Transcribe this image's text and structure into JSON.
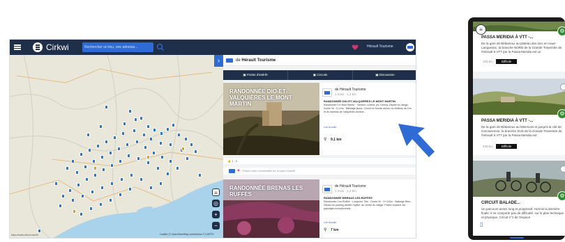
{
  "desktop": {
    "app_name": "Cirkwi",
    "search_placeholder": "Rechercher un lieu, une adresse...",
    "account_label": "Hérault Tourisme",
    "map": {
      "attribution": "Leaflet | © OpenStreetMap contributors © CARTO",
      "url": "https://www.cirkwi.com/fr/"
    },
    "panel": {
      "source_prefix": "de",
      "source_name": "Hérault Tourisme",
      "tabs": [
        {
          "label": "Points d'intérêt"
        },
        {
          "label": "Circuits"
        },
        {
          "label": "Discussion"
        }
      ],
      "cards": [
        {
          "title": "RANDONNÉE DIO-ET-VALQUIÈRES LE MONT MARTIN",
          "publisher": "de Hérault Tourisme",
          "meta": "1 mois · 1,2 km",
          "heading": "RANDONNÉE DIO-ET-VALQUIÈRES LE MONT MARTIN",
          "description": "Randonnée 'Le Mont Martin' · Secteur Lodève, pic Cerezy. Départ du village. Durée 3h · 9,1 km · Balisage jaune. Circuit en boucle autour du château de Dio et du hameau de Valquières dominé...",
          "more_label": "Lire la suite",
          "distance": "9.1 km"
        },
        {
          "title": "RANDONNÉE BRENAS LES RUFFES",
          "publisher": "de Hérault Tourisme",
          "meta": "1 mois · 1,2 km",
          "heading": "RANDONNÉE BRENAS LES RUFFES",
          "description": "Randonnée 'Les Ruffes' · Longueur 7km · Durée 2h · D+120m · Balisage Bleu. Départ du parking devant l'église, au centre du village. Partez explorer les paysages exceptionnels...",
          "more_label": "Lire la suite",
          "distance": "7 km"
        }
      ],
      "likes": "1 · 0",
      "comment_placeholder": "Postez votre commentaire sur ce point d'intérêt"
    }
  },
  "mobile": {
    "cards": [
      {
        "title": "PASSA MERIDIA À VTT -...",
        "description": "De la gare de Bédarieux au plateau des lacs en Haut-Languedoc, la branche NORD de la Grande Traversée de l'Hérault à VTT par la Passa Meridia est un",
        "distance": "100 km",
        "level": "Difficile"
      },
      {
        "title": "PASSA MERIDIA À VTT -...",
        "description": "De la gare de Bédarieux au Minervois et jusqu'à la cité de Carcassonne, la branche SUD de la Grande Traversée de l'Hérault à VTT par la Passa Meridia est",
        "distance": "230 km",
        "level": "Difficile"
      },
      {
        "title": "CIRCUIT BALADE...",
        "description": "Un parcours assez long et progressif. Hormis la dernière finale, il ne comporte pas de difficulté, sur le plan technique et physique. Circuit n°1 de l'espace",
        "distance": "",
        "level": ""
      }
    ]
  },
  "colors": {
    "navy": "#1f2f4a",
    "accent_blue": "#2e6bd6",
    "marker_blue": "#1e7de0",
    "bike_green": "#2e8b2e"
  },
  "icons": [
    "hamburger-menu-icon",
    "cirkwi-logo-icon",
    "search-icon",
    "collapse-arrow-icon",
    "layers-icon",
    "locate-icon",
    "zoom-in-icon",
    "zoom-out-icon",
    "bike-icon",
    "heart-icon",
    "hiker-icon",
    "pointer-arrow-icon"
  ]
}
